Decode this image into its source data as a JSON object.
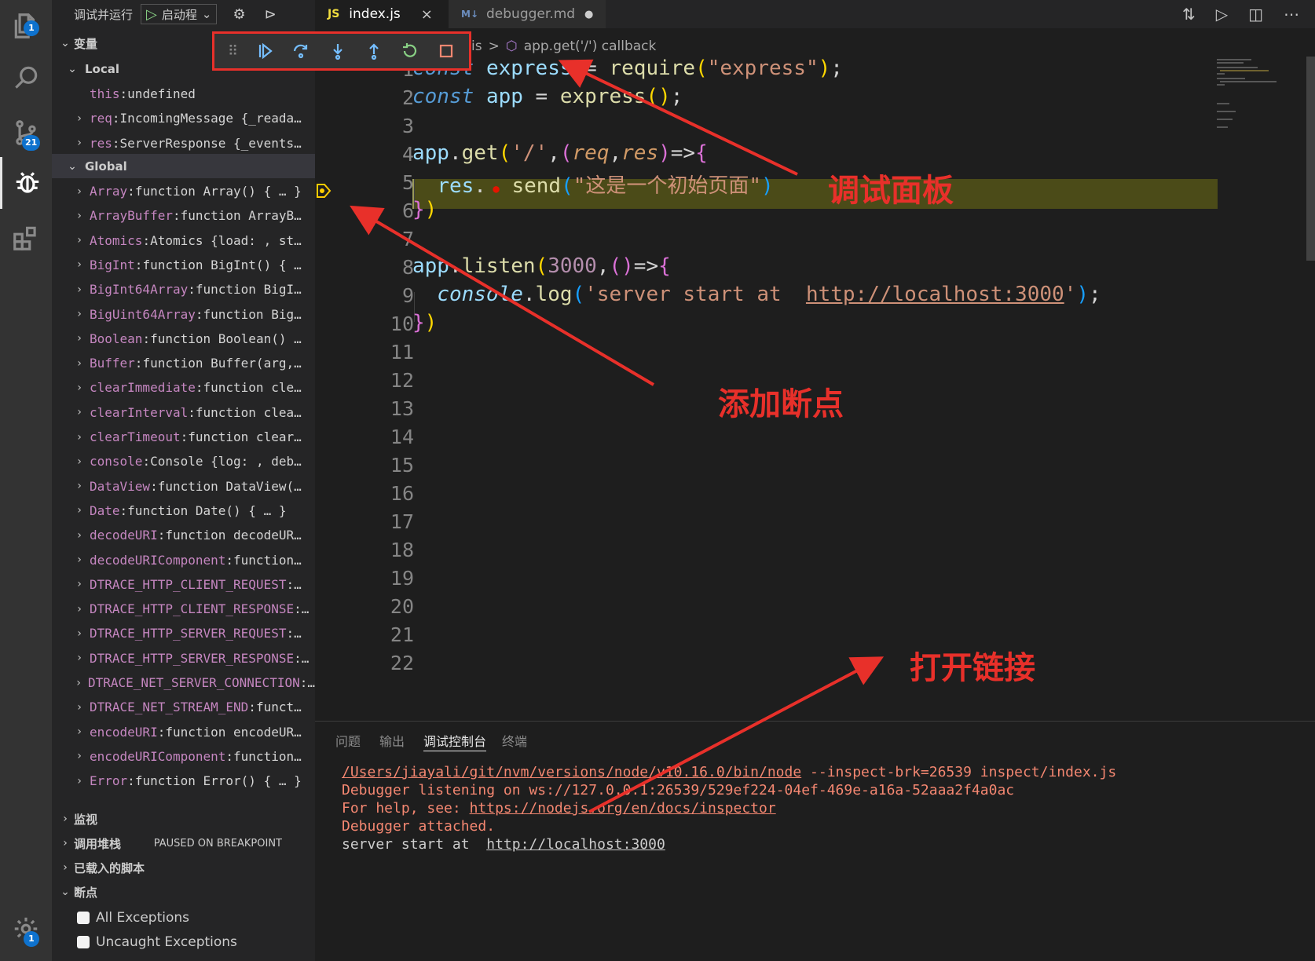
{
  "activity": {
    "explorer_badge": "1",
    "scm_badge": "21",
    "settings_badge": "1"
  },
  "sidebar": {
    "run_label": "调试并运行",
    "launch_config": "启动程",
    "variables_header": "变量",
    "local_header": "Local",
    "global_header": "Global",
    "local_vars": [
      {
        "name": "this",
        "value": "undefined"
      },
      {
        "name": "req",
        "value": "IncomingMessage {_reada…"
      },
      {
        "name": "res",
        "value": "ServerResponse {_events…"
      }
    ],
    "global_vars": [
      {
        "name": "Array",
        "value": "function Array() { … }"
      },
      {
        "name": "ArrayBuffer",
        "value": "function ArrayB…"
      },
      {
        "name": "Atomics",
        "value": "Atomics {load: , st…"
      },
      {
        "name": "BigInt",
        "value": "function BigInt() { …"
      },
      {
        "name": "BigInt64Array",
        "value": "function BigI…"
      },
      {
        "name": "BigUint64Array",
        "value": "function Big…"
      },
      {
        "name": "Boolean",
        "value": "function Boolean() …"
      },
      {
        "name": "Buffer",
        "value": "function Buffer(arg,…"
      },
      {
        "name": "clearImmediate",
        "value": "function cle…"
      },
      {
        "name": "clearInterval",
        "value": "function clea…"
      },
      {
        "name": "clearTimeout",
        "value": "function clear…"
      },
      {
        "name": "console",
        "value": "Console {log: , deb…"
      },
      {
        "name": "DataView",
        "value": "function DataView(…"
      },
      {
        "name": "Date",
        "value": "function Date() { … }"
      },
      {
        "name": "decodeURI",
        "value": "function decodeUR…"
      },
      {
        "name": "decodeURIComponent",
        "value": "function…"
      },
      {
        "name": "DTRACE_HTTP_CLIENT_REQUEST",
        "value": "…"
      },
      {
        "name": "DTRACE_HTTP_CLIENT_RESPONSE",
        "value": "…"
      },
      {
        "name": "DTRACE_HTTP_SERVER_REQUEST",
        "value": "…"
      },
      {
        "name": "DTRACE_HTTP_SERVER_RESPONSE",
        "value": "…"
      },
      {
        "name": "DTRACE_NET_SERVER_CONNECTION",
        "value": "…"
      },
      {
        "name": "DTRACE_NET_STREAM_END",
        "value": "funct…"
      },
      {
        "name": "encodeURI",
        "value": "function encodeUR…"
      },
      {
        "name": "encodeURIComponent",
        "value": "function…"
      },
      {
        "name": "Error",
        "value": "function Error() { … }"
      }
    ],
    "watch_header": "监视",
    "callstack_header": "调用堆栈",
    "callstack_status": "PAUSED ON BREAKPOINT",
    "loaded_scripts_header": "已载入的脚本",
    "breakpoints_header": "断点",
    "breakpoints": [
      {
        "label": "All Exceptions",
        "checked": false
      },
      {
        "label": "Uncaught Exceptions",
        "checked": false
      }
    ]
  },
  "tabs": [
    {
      "icon": "JS",
      "label": "index.js",
      "active": true,
      "close": "×"
    },
    {
      "icon": "M↓",
      "label": "debugger.md",
      "active": false,
      "close": "●"
    }
  ],
  "breadcrumb": {
    "file": "is",
    "separator": ">",
    "symbol": "app.get('/') callback"
  },
  "editor": {
    "line_numbers": [
      "1",
      "2",
      "3",
      "4",
      "5",
      "6",
      "7",
      "8",
      "9",
      "10",
      "11",
      "12",
      "13",
      "14",
      "15",
      "16",
      "17",
      "18",
      "19",
      "20",
      "21",
      "22"
    ],
    "current_line": 5
  },
  "panel": {
    "tabs": [
      "问题",
      "输出",
      "调试控制台",
      "终端"
    ],
    "active_tab": "调试控制台",
    "console": {
      "path": "/Users/jiayali/git/nvm/versions/node/v10.16.0/bin/node",
      "args": " --inspect-brk=26539 inspect/index.js",
      "listening": "Debugger listening on ws://127.0.0.1:26539/529ef224-04ef-469e-a16a-52aaa2f4a0ac",
      "help_prefix": "For help, see: ",
      "help_link": "https://nodejs.org/en/docs/inspector",
      "attached": "Debugger attached.",
      "server_prefix": "server start at  ",
      "server_link": "http://localhost:3000"
    }
  },
  "annotations": {
    "debug_panel": "调试面板",
    "add_breakpoint": "添加断点",
    "open_link": "打开链接"
  },
  "colors": {
    "annotation": "#e8302a",
    "accent_blue": "#0e72ce",
    "current_line": "#4b4b18"
  }
}
